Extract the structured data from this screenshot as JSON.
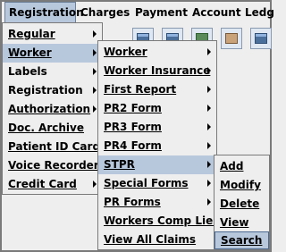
{
  "menubar": {
    "items": [
      {
        "label": "Registration"
      },
      {
        "label": "Charges"
      },
      {
        "label": "Payment"
      },
      {
        "label": "Account"
      },
      {
        "label": "Ledg"
      }
    ]
  },
  "main_menu": {
    "items": [
      {
        "label": "Regular"
      },
      {
        "label": "Worker"
      },
      {
        "label": "Labels"
      },
      {
        "label": "Registration"
      },
      {
        "label": "Authorization"
      },
      {
        "label": "Doc. Archive"
      },
      {
        "label": "Patient ID Card"
      },
      {
        "label": "Voice Recorder"
      },
      {
        "label": "Credit Card"
      }
    ]
  },
  "worker_menu": {
    "items": [
      {
        "label": "Worker"
      },
      {
        "label": "Worker Insurance"
      },
      {
        "label": "First Report"
      },
      {
        "label": "PR2 Form"
      },
      {
        "label": "PR3 Form"
      },
      {
        "label": "PR4 Form"
      },
      {
        "label": "STPR"
      },
      {
        "label": "Special Forms"
      },
      {
        "label": "PR Forms"
      },
      {
        "label": "Workers Comp Lien"
      },
      {
        "label": "View All Claims"
      }
    ]
  },
  "stpr_menu": {
    "items": [
      {
        "label": "Add"
      },
      {
        "label": "Modify"
      },
      {
        "label": "Delete"
      },
      {
        "label": "View"
      },
      {
        "label": "Search"
      }
    ]
  },
  "colors": {
    "menu_bg": "#eeeeee",
    "selected_bg": "#b8c8dc",
    "border": "#7a7a7a"
  }
}
